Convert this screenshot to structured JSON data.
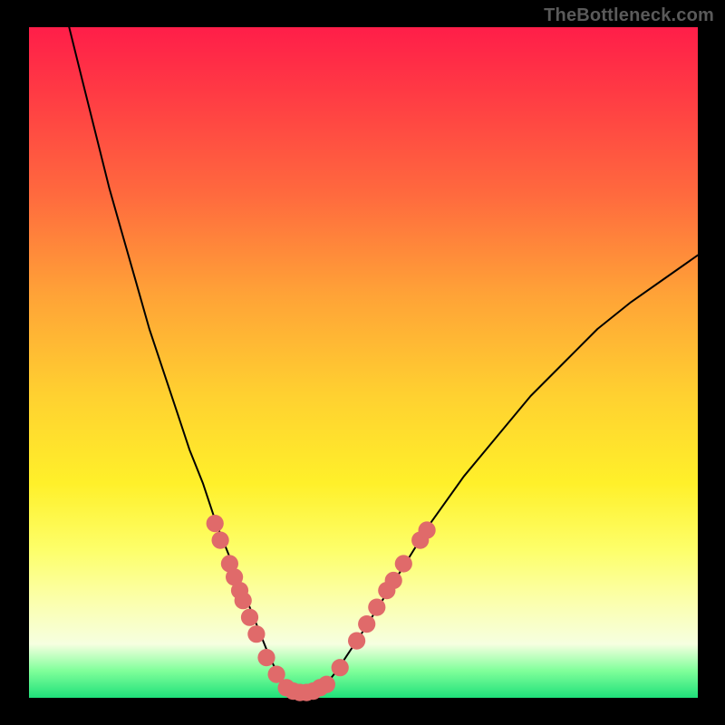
{
  "watermark": "TheBottleneck.com",
  "chart_data": {
    "type": "line",
    "title": "",
    "xlabel": "",
    "ylabel": "",
    "xlim": [
      0,
      100
    ],
    "ylim": [
      0,
      100
    ],
    "grid": false,
    "series": [
      {
        "name": "curve",
        "color": "#000000",
        "x": [
          6,
          8,
          10,
          12,
          14,
          16,
          18,
          20,
          22,
          24,
          26,
          28,
          30,
          32,
          34,
          35,
          36,
          37,
          38,
          40,
          42,
          44,
          46,
          50,
          55,
          60,
          65,
          70,
          75,
          80,
          85,
          90,
          95,
          100
        ],
        "y": [
          100,
          92,
          84,
          76,
          69,
          62,
          55,
          49,
          43,
          37,
          32,
          26,
          21,
          16,
          11,
          8.5,
          6,
          4,
          2.5,
          0.8,
          0.5,
          1.5,
          4,
          10,
          18,
          26,
          33,
          39,
          45,
          50,
          55,
          59,
          62.5,
          66
        ]
      }
    ],
    "scatter_points": {
      "name": "markers",
      "color": "#e06a6a",
      "radius_pct": 1.3,
      "points": [
        {
          "x": 27.8,
          "y": 26.0
        },
        {
          "x": 28.6,
          "y": 23.5
        },
        {
          "x": 30.0,
          "y": 20.0
        },
        {
          "x": 30.7,
          "y": 18.0
        },
        {
          "x": 31.5,
          "y": 16.0
        },
        {
          "x": 32.0,
          "y": 14.5
        },
        {
          "x": 33.0,
          "y": 12.0
        },
        {
          "x": 34.0,
          "y": 9.5
        },
        {
          "x": 35.5,
          "y": 6.0
        },
        {
          "x": 37.0,
          "y": 3.5
        },
        {
          "x": 38.5,
          "y": 1.5
        },
        {
          "x": 39.5,
          "y": 1.0
        },
        {
          "x": 40.5,
          "y": 0.8
        },
        {
          "x": 41.5,
          "y": 0.8
        },
        {
          "x": 42.5,
          "y": 1.0
        },
        {
          "x": 43.5,
          "y": 1.5
        },
        {
          "x": 44.5,
          "y": 2.0
        },
        {
          "x": 46.5,
          "y": 4.5
        },
        {
          "x": 49.0,
          "y": 8.5
        },
        {
          "x": 50.5,
          "y": 11.0
        },
        {
          "x": 52.0,
          "y": 13.5
        },
        {
          "x": 53.5,
          "y": 16.0
        },
        {
          "x": 54.5,
          "y": 17.5
        },
        {
          "x": 56.0,
          "y": 20.0
        },
        {
          "x": 58.5,
          "y": 23.5
        },
        {
          "x": 59.5,
          "y": 25.0
        }
      ]
    }
  }
}
